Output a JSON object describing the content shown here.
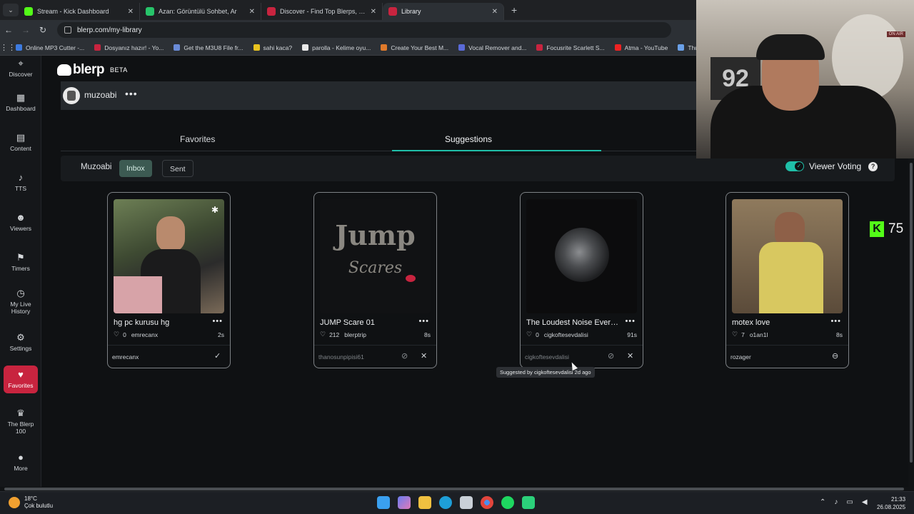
{
  "browser": {
    "tabs": [
      {
        "title": "Stream - Kick Dashboard",
        "color": "#53fc18"
      },
      {
        "title": "Azan: Görüntülü Sohbet, Ar",
        "color": "#27c46a"
      },
      {
        "title": "Discover - Find Top Blerps, Stre",
        "color": "#c8243f"
      },
      {
        "title": "Library",
        "color": "#c8243f"
      }
    ],
    "url": "blerp.com/my-library",
    "bookmarks": [
      {
        "label": "Online MP3 Cutter -...",
        "color": "#3d7be0"
      },
      {
        "label": "Dosyanız hazır! - Yo...",
        "color": "#c8243f"
      },
      {
        "label": "Get the M3U8 File fr...",
        "color": "#6a8bd8"
      },
      {
        "label": "sahi kaca?",
        "color": "#e8c21f"
      },
      {
        "label": "parolla - Kelime oyu...",
        "color": "#e9e9e9"
      },
      {
        "label": "Create Your Best M...",
        "color": "#e07a2b"
      },
      {
        "label": "Vocal Remover and...",
        "color": "#5a6ad8"
      },
      {
        "label": "Focusrite Scarlett S...",
        "color": "#c8243f"
      },
      {
        "label": "Atma - YouTube",
        "color": "#e22"
      },
      {
        "label": "Thumbs Up – Sta",
        "color": "#6aa0e8"
      }
    ]
  },
  "sidebar": {
    "items": [
      {
        "label": "Discover",
        "icon": "compass-icon"
      },
      {
        "label": "Dashboard",
        "icon": "grid-icon"
      },
      {
        "label": "Content",
        "icon": "content-icon"
      },
      {
        "label": "TTS",
        "icon": "mic-icon"
      },
      {
        "label": "Viewers",
        "icon": "people-icon"
      },
      {
        "label": "Timers",
        "icon": "flag-icon"
      },
      {
        "label": "My Live History",
        "icon": "history-icon"
      },
      {
        "label": "Settings",
        "icon": "gear-icon"
      },
      {
        "label": "Favorites",
        "icon": "heart-icon"
      },
      {
        "label": "The Blerp 100",
        "icon": "crown-icon"
      },
      {
        "label": "More",
        "icon": "more-icon"
      }
    ]
  },
  "header": {
    "brand": "blerp",
    "beta": "BETA"
  },
  "user": {
    "name": "muzoabi"
  },
  "tabs": {
    "favorites": "Favorites",
    "suggestions": "Suggestions"
  },
  "filters": {
    "owner": "Muzoabi",
    "inbox": "Inbox",
    "sent": "Sent",
    "viewer_voting": "Viewer Voting",
    "viewer_voting_on": true
  },
  "cards": [
    {
      "title": "hg pc kurusu hg",
      "likes": "0",
      "author": "emrecanx",
      "duration": "2s",
      "suggested_by": "emrecanx",
      "state": "approved"
    },
    {
      "title": "JUMP Scare 01",
      "likes": "212",
      "author": "blerptrip",
      "duration": "8s",
      "suggested_by": "thanosunpipisi61",
      "state": "pending",
      "thumb_text_1": "Jump",
      "thumb_text_2": "Scares"
    },
    {
      "title": "The Loudest Noise Ever Pos",
      "likes": "0",
      "author": "cigkoftesevdalisi",
      "duration": "91s",
      "suggested_by": "cigkoftesevdalisi",
      "state": "pending"
    },
    {
      "title": "motex love",
      "likes": "7",
      "author": "o1an1l",
      "duration": "8s",
      "suggested_by": "rozager",
      "state": "removed"
    }
  ],
  "tooltip": "Suggested by cigkoftesevdalisi 2d ago",
  "stream": {
    "onair": "ON AIR",
    "jersey": "92",
    "kick_count": "75"
  },
  "taskbar": {
    "temp": "18°C",
    "weather": "Çok bulutlu",
    "time": "21:33",
    "date": "26.08.2025"
  }
}
